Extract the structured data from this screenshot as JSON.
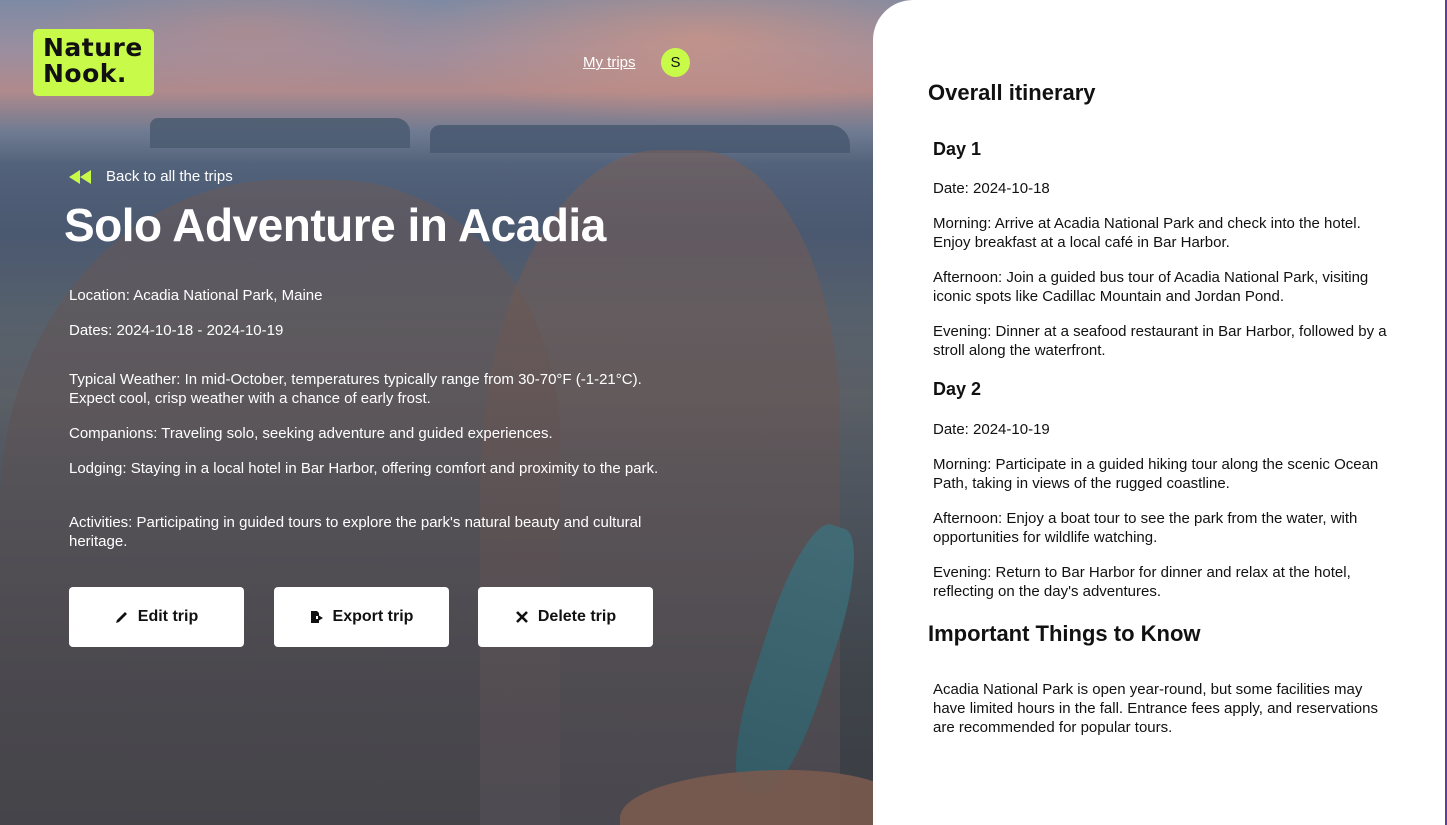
{
  "brand": {
    "logo_line1": "Nature",
    "logo_line2": "Nook.",
    "accent_color": "#c8fa4a"
  },
  "nav": {
    "my_trips": "My trips",
    "avatar_initial": "S"
  },
  "trip": {
    "back_label": "Back to all the trips",
    "title": "Solo Adventure in Acadia",
    "location": "Location: Acadia National Park, Maine",
    "dates": "Dates: 2024-10-18 - 2024-10-19",
    "weather": "Typical Weather: In mid-October, temperatures typically range from 30-70°F (-1-21°C). Expect cool, crisp weather with a chance of early frost.",
    "companions": "Companions: Traveling solo, seeking adventure and guided experiences.",
    "lodging": "Lodging: Staying in a local hotel in Bar Harbor, offering comfort and proximity to the park.",
    "activities": "Activities: Participating in guided tours to explore the park's natural beauty and cultural heritage."
  },
  "actions": {
    "edit": "Edit trip",
    "export": "Export trip",
    "delete": "Delete trip"
  },
  "itinerary": {
    "heading": "Overall itinerary",
    "days": [
      {
        "title": "Day 1",
        "date": "Date: 2024-10-18",
        "morning": "Morning: Arrive at Acadia National Park and check into the hotel. Enjoy breakfast at a local café in Bar Harbor.",
        "afternoon": "Afternoon: Join a guided bus tour of Acadia National Park, visiting iconic spots like Cadillac Mountain and Jordan Pond.",
        "evening": "Evening: Dinner at a seafood restaurant in Bar Harbor, followed by a stroll along the waterfront."
      },
      {
        "title": "Day 2",
        "date": "Date: 2024-10-19",
        "morning": "Morning: Participate in a guided hiking tour along the scenic Ocean Path, taking in views of the rugged coastline.",
        "afternoon": "Afternoon: Enjoy a boat tour to see the park from the water, with opportunities for wildlife watching.",
        "evening": "Evening: Return to Bar Harbor for dinner and relax at the hotel, reflecting on the day's adventures."
      }
    ]
  },
  "important": {
    "heading": "Important Things to Know",
    "text": "Acadia National Park is open year-round, but some facilities may have limited hours in the fall. Entrance fees apply, and reservations are recommended for popular tours."
  }
}
